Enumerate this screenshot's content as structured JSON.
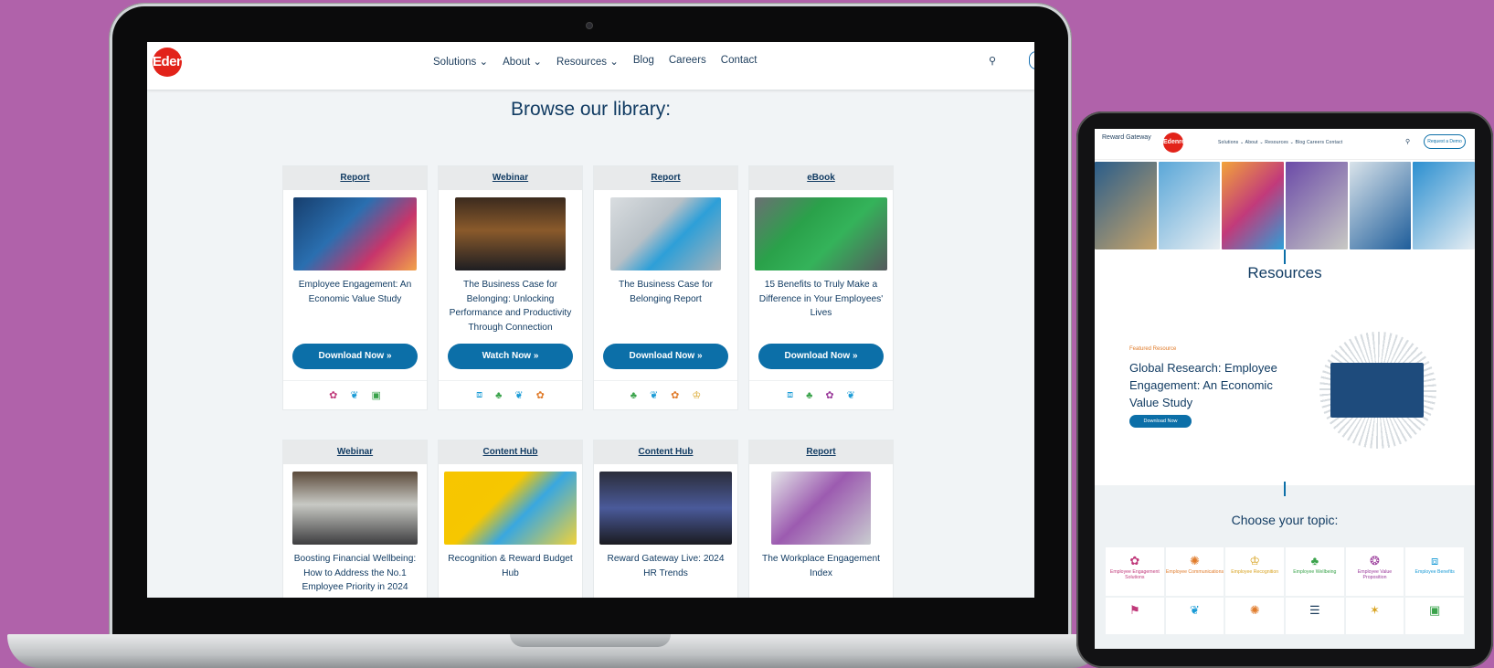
{
  "colors": {
    "background": "#b062aa",
    "primary": "#0c6fa8",
    "heading": "#123c63",
    "brand_red": "#e2231a"
  },
  "laptop": {
    "logo_text": "Edenred",
    "nav": [
      "Solutions ⌄",
      "About ⌄",
      "Resources ⌄",
      "Blog",
      "Careers",
      "Contact"
    ],
    "search_icon": "search-icon",
    "heading": "Browse our library:",
    "cards": [
      {
        "category": "Report",
        "title": "Employee Engagement: An Economic Value Study",
        "button": "Download Now »",
        "icons": [
          "✿",
          "❦",
          "▣"
        ]
      },
      {
        "category": "Webinar",
        "title": "The Business Case for Belonging: Unlocking Performance and Productivity Through Connection",
        "button": "Watch Now »",
        "icons": [
          "⧈",
          "♣",
          "❦",
          "✿"
        ]
      },
      {
        "category": "Report",
        "title": "The Business Case for Belonging Report",
        "button": "Download Now »",
        "icons": [
          "♣",
          "❦",
          "✿",
          "♔"
        ]
      },
      {
        "category": "eBook",
        "title": "15 Benefits to Truly Make a Difference in Your Employees' Lives",
        "button": "Download Now »",
        "icons": [
          "⧈",
          "♣",
          "✿",
          "❦"
        ]
      },
      {
        "category": "Webinar",
        "title": "Boosting Financial Wellbeing: How to Address the No.1 Employee Priority in 2024"
      },
      {
        "category": "Content Hub",
        "title": "Recognition & Reward Budget Hub"
      },
      {
        "category": "Content Hub",
        "title": "Reward Gateway Live: 2024 HR Trends"
      },
      {
        "category": "Report",
        "title": "The Workplace Engagement Index"
      }
    ]
  },
  "tablet": {
    "logo_rg": "Reward Gateway",
    "logo_ed": "Edenred",
    "nav": "Solutions ⌄   About ⌄   Resources ⌄   Blog   Careers   Contact",
    "header_button": "Request a Demo",
    "resources_title": "Resources",
    "featured_label": "Featured Resource",
    "featured_title": "Global Research: Employee Engagement: An Economic Value Study",
    "featured_button": "Download Now",
    "choose_title": "Choose your topic:",
    "topics": [
      {
        "icon": "✿",
        "label": "Employee Engagement Solutions",
        "color": "#c0397a"
      },
      {
        "icon": "✺",
        "label": "Employee Communications",
        "color": "#e07b2a"
      },
      {
        "icon": "♔",
        "label": "Employee Recognition",
        "color": "#d8a21f"
      },
      {
        "icon": "♣",
        "label": "Employee Wellbeing",
        "color": "#3aa34b"
      },
      {
        "icon": "❂",
        "label": "Employee Value Proposition",
        "color": "#9a3a9a"
      },
      {
        "icon": "⧈",
        "label": "Employee Benefits",
        "color": "#1a9bd6"
      }
    ],
    "topics_row2": [
      {
        "icon": "⚑",
        "color": "#c0397a"
      },
      {
        "icon": "❦",
        "color": "#1a9bd6"
      },
      {
        "icon": "✺",
        "color": "#e07b2a"
      },
      {
        "icon": "☰",
        "color": "#1d3d5c"
      },
      {
        "icon": "✶",
        "color": "#d8a21f"
      },
      {
        "icon": "▣",
        "color": "#3aa34b"
      }
    ]
  }
}
